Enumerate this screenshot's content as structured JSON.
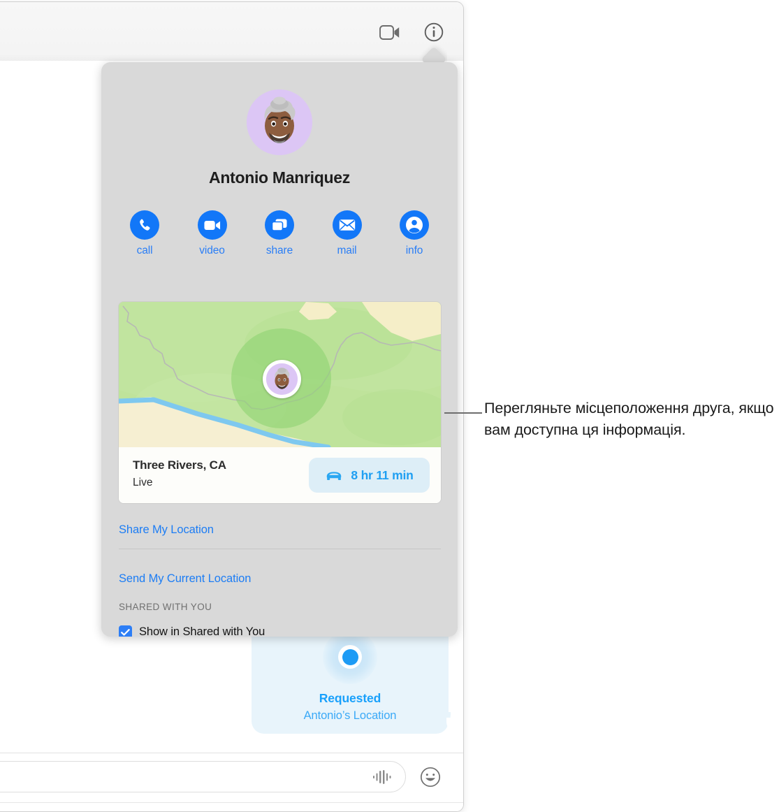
{
  "window": {
    "toolbar": {
      "facetime_icon": "video-camera-icon",
      "details_icon": "info-circle-icon"
    }
  },
  "conversation": {
    "request_bubble": {
      "icon": "location-dot-icon",
      "title": "Requested",
      "subtitle": "Antonio’s Location"
    }
  },
  "composer": {
    "placeholder": "",
    "value": "",
    "audio_icon": "audio-waveform-icon",
    "emoji_icon": "smiley-face-icon"
  },
  "popover": {
    "avatar_name": "memoji-avatar",
    "contact_name": "Antonio Manriquez",
    "actions": [
      {
        "label": "call",
        "icon": "phone-icon"
      },
      {
        "label": "video",
        "icon": "video-camera-icon"
      },
      {
        "label": "share",
        "icon": "screen-share-icon"
      },
      {
        "label": "mail",
        "icon": "envelope-icon"
      },
      {
        "label": "info",
        "icon": "person-circle-icon"
      }
    ],
    "map": {
      "pin_icon": "memoji-map-pin",
      "place_name": "Three Rivers, CA",
      "status": "Live",
      "eta_icon": "car-icon",
      "eta_text": "8 hr 11 min"
    },
    "share_my_location": "Share My Location",
    "send_my_current_location": "Send My Current Location",
    "section_header": "SHARED WITH YOU",
    "checkbox_label": "Show in Shared with You",
    "checkbox_checked": true
  },
  "annotation": {
    "text": "Перегляньте місцеположення друга, якщо вам доступна ця інформація."
  },
  "colors": {
    "accent_blue": "#1277f8",
    "link_blue": "#1d7df4",
    "bubble_blue": "#e8f4fb",
    "popover_gray": "#d9d9d9",
    "map_green": "#bfe39b"
  }
}
